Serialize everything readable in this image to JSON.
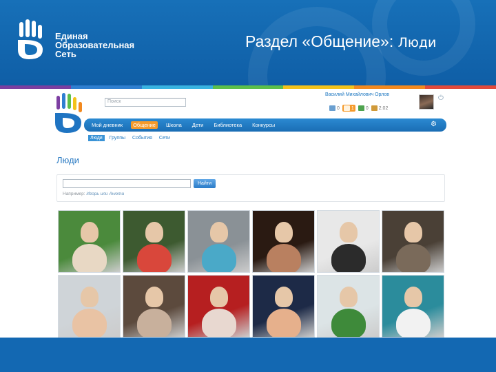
{
  "slide": {
    "brand_lines": [
      "Единая",
      "Образовательная",
      "Сеть"
    ],
    "title_main": "Раздел «Общение»: ",
    "title_sub": "Люди"
  },
  "site": {
    "search_placeholder": "Поиск",
    "user_name": "Василий Михайлович Орлов",
    "counters": [
      {
        "icon": "mail-icon",
        "value": "0",
        "color": "#6a9fd0"
      },
      {
        "icon": "friends-icon",
        "value": "1",
        "color": "#f59a2b",
        "active": true
      },
      {
        "icon": "puzzle-icon",
        "value": "0",
        "color": "#4fa34f"
      },
      {
        "icon": "people-icon",
        "value": "2.02",
        "color": "#d09a3a"
      }
    ],
    "nav": [
      "Мой дневник",
      "Общение",
      "Школа",
      "Дети",
      "Библиотека",
      "Конкурсы"
    ],
    "nav_active": "Общение",
    "subnav": [
      "Люди",
      "Группы",
      "События",
      "Сети"
    ],
    "subnav_active": "Люди",
    "section_title": "Люди",
    "find_button": "Найти",
    "hint_prefix": "Например: ",
    "hint_example": "Игорь или Анюта"
  },
  "photos": [
    {
      "label": "person-in-garden",
      "bg": "#4b8a3c",
      "fig": "#e8d8c4"
    },
    {
      "label": "woman-in-red",
      "bg": "#3d5a30",
      "fig": "#d9473b"
    },
    {
      "label": "boy-with-car",
      "bg": "#8a9196",
      "fig": "#4aa9c8"
    },
    {
      "label": "girl-portrait",
      "bg": "#2a1a12",
      "fig": "#b98060"
    },
    {
      "label": "girl-dark-photo",
      "bg": "#e8e8e8",
      "fig": "#2b2b2b"
    },
    {
      "label": "man-in-room",
      "bg": "#4a4036",
      "fig": "#7a6a5a"
    },
    {
      "label": "boy-portrait",
      "bg": "#cfd4d8",
      "fig": "#e9c3a4"
    },
    {
      "label": "girl-with-dog",
      "bg": "#5c4a3d",
      "fig": "#c8b09c"
    },
    {
      "label": "hammer-and-sickle",
      "bg": "#b61f20",
      "fig": "#e8d8d0"
    },
    {
      "label": "girl-with-crown",
      "bg": "#1d2a47",
      "fig": "#e6b08c"
    },
    {
      "label": "kids-at-table",
      "bg": "#dce4e6",
      "fig": "#3e8a3a"
    },
    {
      "label": "boy-on-floor",
      "bg": "#2b8c9c",
      "fig": "#f2f2f2"
    }
  ]
}
